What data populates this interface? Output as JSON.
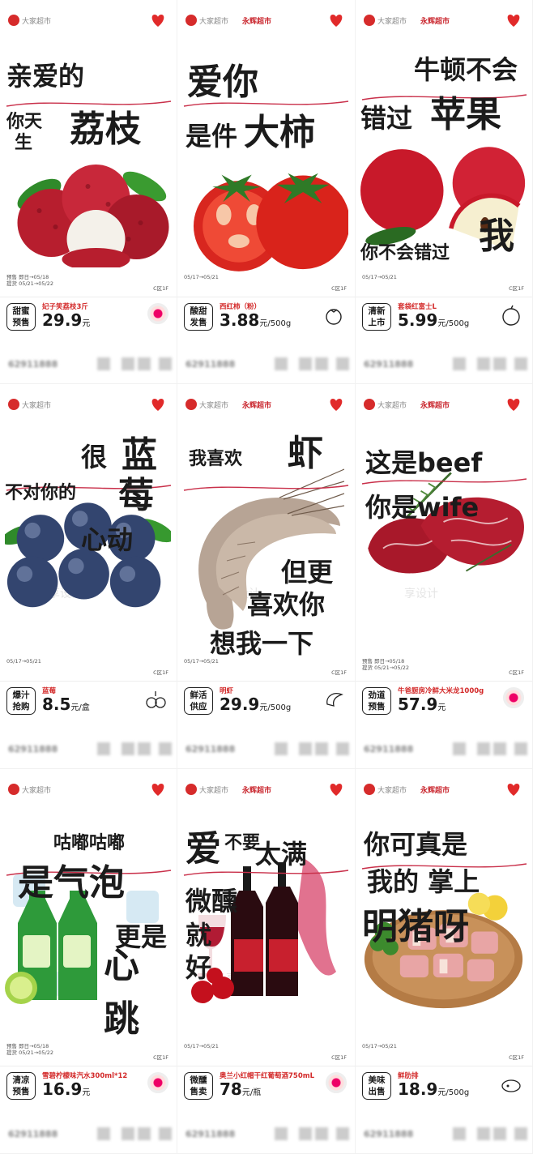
{
  "brand_logo_text": "永辉超市",
  "store_logo_text": "大家超市",
  "watermark": "享设计",
  "phone": "62911888",
  "floor": "C区1F",
  "posters": [
    {
      "lines": [
        "亲爱的",
        "你天",
        "生",
        "荔枝"
      ],
      "tag": "甜蜜\n预售",
      "product": "妃子笑荔枝3斤",
      "price": "29.9",
      "unit": "元",
      "dates": "预售 即日→05/18\n提货 05/21→05/22",
      "art": "lychee"
    },
    {
      "lines": [
        "爱你",
        "是件",
        "大柿"
      ],
      "tag": "酸甜\n发售",
      "product": "西红柿（粉）",
      "price": "3.88",
      "unit": "元/500g",
      "dates": "05/17→05/21",
      "art": "tomato"
    },
    {
      "lines": [
        "牛顿不会",
        "错过",
        "苹果",
        "你不会错过",
        "我"
      ],
      "tag": "清新\n上市",
      "product": "套袋红富士L",
      "price": "5.99",
      "unit": "元/500g",
      "dates": "05/17→05/21",
      "art": "apple"
    },
    {
      "lines": [
        "很",
        "蓝",
        "不对你的",
        "莓",
        "心动"
      ],
      "tag": "爆汁\n抢购",
      "product": "蓝莓",
      "price": "8.5",
      "unit": "元/盒",
      "dates": "05/17→05/21",
      "art": "blueberry"
    },
    {
      "lines": [
        "我喜欢",
        "虾",
        "但更",
        "喜欢你",
        "想我一下"
      ],
      "tag": "鲜活\n供应",
      "product": "明虾",
      "price": "29.9",
      "unit": "元/500g",
      "dates": "05/17→05/21",
      "art": "shrimp"
    },
    {
      "lines": [
        "这是beef",
        "你是wife"
      ],
      "tag": "劲道\n预售",
      "product": "牛爸厨房冷鲜大米龙1000g",
      "price": "57.9",
      "unit": "元",
      "dates": "预售 即日→05/18\n提货 05/21→05/22",
      "art": "beef"
    },
    {
      "lines": [
        "咕嘟咕嘟",
        "是气泡",
        "更是",
        "心",
        "跳"
      ],
      "tag": "清凉\n预售",
      "product": "雪碧柠檬味汽水300ml*12",
      "price": "16.9",
      "unit": "元",
      "dates": "预售 即日→05/18\n提货 05/21→05/22",
      "art": "sprite"
    },
    {
      "lines": [
        "爱",
        "不要",
        "太满",
        "微醺",
        "就",
        "好"
      ],
      "tag": "微醺\n售卖",
      "product": "奥兰小红帽干红葡萄酒750mL",
      "price": "78",
      "unit": "元/瓶",
      "dates": "05/17→05/21",
      "art": "wine"
    },
    {
      "lines": [
        "你可真是",
        "我的 掌上",
        "明猪呀"
      ],
      "tag": "美味\n出售",
      "product": "鲜肋排",
      "price": "18.9",
      "unit": "元/500g",
      "dates": "05/17→05/21",
      "art": "ribs"
    }
  ]
}
